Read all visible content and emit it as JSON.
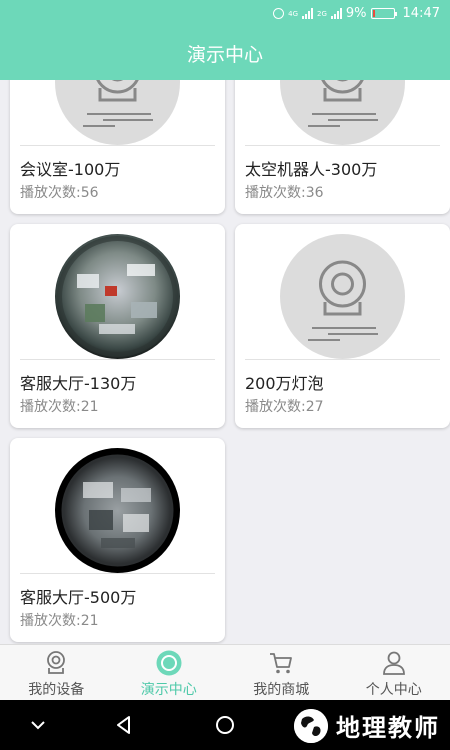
{
  "status_bar": {
    "net_label_1": "4G",
    "net_label_2": "2G",
    "battery_percent": "9%",
    "battery_level": 0.09,
    "time": "14:47"
  },
  "header": {
    "title": "演示中心"
  },
  "cards": [
    {
      "title": "会议室-100万",
      "play_count": "播放次数:56",
      "thumb": "camera-placeholder"
    },
    {
      "title": "太空机器人-300万",
      "play_count": "播放次数:36",
      "thumb": "camera-placeholder"
    },
    {
      "title": "客服大厅-130万",
      "play_count": "播放次数:21",
      "thumb": "fisheye-office-colorful"
    },
    {
      "title": "200万灯泡",
      "play_count": "播放次数:27",
      "thumb": "camera-placeholder"
    },
    {
      "title": "客服大厅-500万",
      "play_count": "播放次数:21",
      "thumb": "fisheye-office-dark"
    }
  ],
  "bottom_nav": [
    {
      "label": "我的设备",
      "icon": "camera-icon",
      "active": false
    },
    {
      "label": "演示中心",
      "icon": "play-circle-icon",
      "active": true
    },
    {
      "label": "我的商城",
      "icon": "cart-icon",
      "active": false
    },
    {
      "label": "个人中心",
      "icon": "person-icon",
      "active": false
    }
  ],
  "watermark": {
    "text": "地理教师"
  },
  "colors": {
    "accent": "#6dd8b9",
    "active_nav": "#4ec9a9",
    "background": "#efeff3"
  }
}
